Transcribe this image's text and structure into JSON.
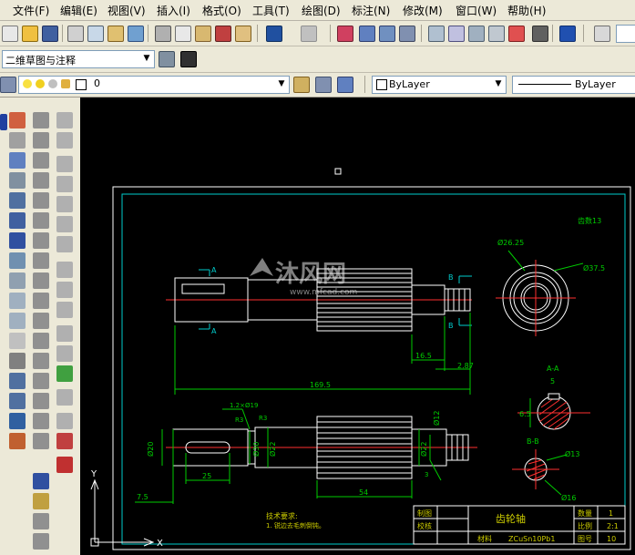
{
  "menu": {
    "items": [
      "文件(F)",
      "编辑(E)",
      "视图(V)",
      "插入(I)",
      "格式(O)",
      "工具(T)",
      "绘图(D)",
      "标注(N)",
      "修改(M)",
      "窗口(W)",
      "帮助(H)"
    ]
  },
  "toolbar2": {
    "workspace": "二维草图与注释"
  },
  "layers": {
    "current_layer": "0",
    "color": "ByLayer",
    "linetype": "ByLayer"
  },
  "drawing": {
    "teeth_note": "齿数13",
    "dim_d1": "Ø26.25",
    "dim_d2": "Ø37.5",
    "section_a": "A",
    "section_b": "B",
    "section_aa": "A-A",
    "section_bb": "B-B",
    "dim_16_5": "16.5",
    "dim_2_87": "2.87",
    "dim_169_5": "169.5",
    "dim_5": "5",
    "dim_6_5": "6.5",
    "dim_13": "Ø13",
    "dim_16": "Ø16",
    "dim_7_5": "7.5",
    "dim_25": "25",
    "dim_54": "54",
    "dim_12": "Ø12",
    "dim_20": "Ø20",
    "dim_30": "Ø30",
    "dim_22": "Ø22",
    "dim_22b": "Ø22",
    "dim_r1": "1.2×Ø19",
    "dim_r2": "R3",
    "dim_r3": "R3",
    "dim_3": "3",
    "tech_title": "技术要求:",
    "tech_body": "1. 锐边去毛刺倒钝。",
    "title_block": {
      "draw": "制图",
      "check": "校核",
      "name": "齿轮轴",
      "material_label": "材料",
      "material": "ZCuSn10Pb1",
      "qty_label": "数量",
      "qty": "1",
      "scale_label": "比例",
      "scale": "2:1",
      "drawing_no_label": "图号",
      "drawing_no": "10"
    },
    "axis_y": "Y",
    "axis_x": "X",
    "watermark_cn": "沐风网",
    "watermark_url": "www.mfcad.com"
  },
  "colors": {
    "canvas_bg": "#000000",
    "line_white": "#ffffff",
    "line_green": "#00cc00",
    "line_cyan": "#00ffff",
    "line_red": "#ff0000",
    "dim_yellow": "#cccc00"
  }
}
